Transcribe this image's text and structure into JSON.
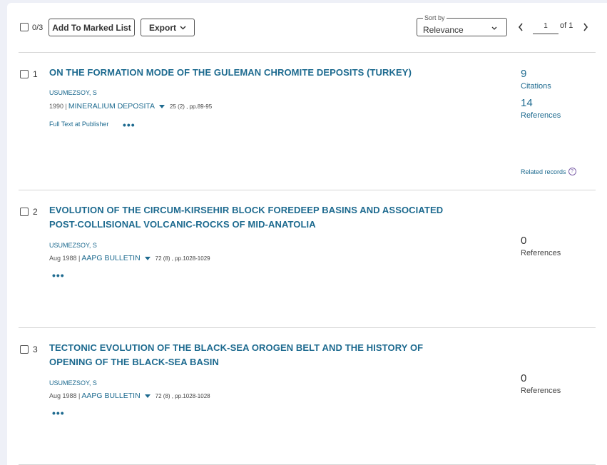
{
  "toolbar": {
    "selected_count": "0/3",
    "add_to_marked_list": "Add To Marked List",
    "export": "Export",
    "sort_by_label": "Sort by",
    "sort_value": "Relevance",
    "page_current": "1",
    "page_total_label": "of 1"
  },
  "records": [
    {
      "index": "1",
      "title": "ON THE FORMATION MODE OF THE GULEMAN CHROMITE DEPOSITS (TURKEY)",
      "author": "USUMEZSOY, S",
      "date": "1990 |",
      "journal": "MINERALIUM DEPOSITA",
      "volume": "25 (2) , pp.89-95",
      "full_text": "Full Text at Publisher",
      "citations_count": "9",
      "citations_label": "Citations",
      "references_count": "14",
      "references_label": "References",
      "related_label": "Related records"
    },
    {
      "index": "2",
      "title": "EVOLUTION OF THE CIRCUM-KIRSEHIR BLOCK FOREDEEP BASINS AND ASSOCIATED POST-COLLISIONAL VOLCANIC-ROCKS OF MID-ANATOLIA",
      "author": "USUMEZSOY, S",
      "date": "Aug 1988 |",
      "journal": "AAPG BULLETIN",
      "volume": "72 (8) , pp.1028-1029",
      "references_count": "0",
      "references_label": "References"
    },
    {
      "index": "3",
      "title": "TECTONIC EVOLUTION OF THE BLACK-SEA OROGEN BELT AND THE HISTORY OF OPENING OF THE BLACK-SEA BASIN",
      "author": "USUMEZSOY, S",
      "date": "Aug 1988 |",
      "journal": "AAPG BULLETIN",
      "volume": "72 (8) , pp.1028-1028",
      "references_count": "0",
      "references_label": "References"
    }
  ],
  "icons": {
    "more": "more-options-icon",
    "caret": "caret-down-icon",
    "help": "help-icon"
  },
  "colors": {
    "link": "#1d6a8f",
    "background": "#eef0f7"
  }
}
